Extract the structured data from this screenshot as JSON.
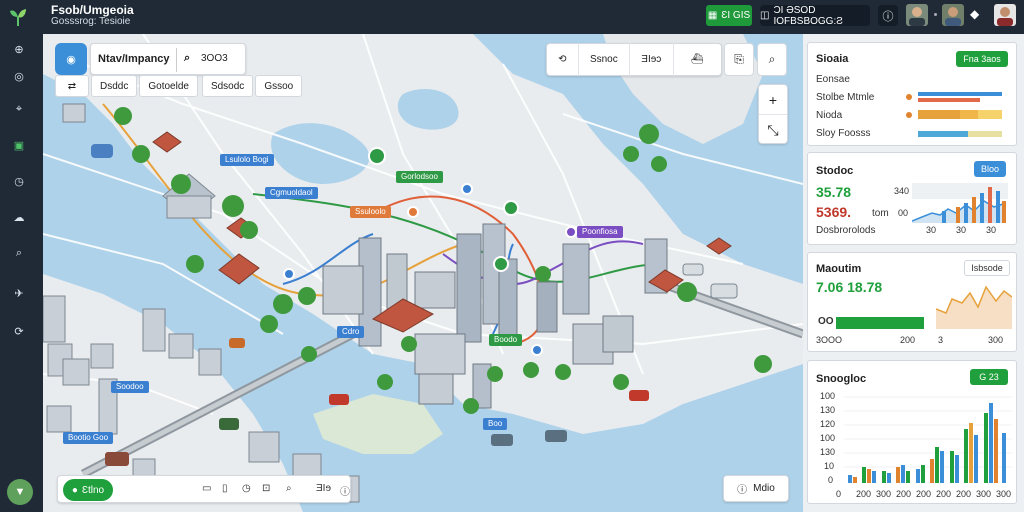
{
  "header": {
    "title": "Fsob/Umgeoia",
    "subtitle": "Gosssrog: Tesioie",
    "action_label": "ƐI GIS",
    "search_label": "ƆI ƏSOD IOFBSBOGG:Ƨ",
    "action_icon": "grid-icon",
    "search_icon": "chart-icon"
  },
  "sidebar": {
    "icons": [
      "globe-icon",
      "compass-icon",
      "pin-icon",
      "layers-icon",
      "clock-icon",
      "cloud-icon",
      "search-icon",
      "satellite-icon",
      "sync-icon"
    ],
    "bottom_icon": "filter-icon"
  },
  "map": {
    "search": {
      "label": "Ntav/Impancy",
      "query": "3OO3"
    },
    "filters": [
      "Dsddc",
      "Gotoelde",
      "Sdsodc",
      "Gssoo"
    ],
    "tool_tabs": [
      "Ssnoc",
      "ƎIɘɔ"
    ],
    "bottom_bar": {
      "pill": "Ɛtlno",
      "icons": [
        "calendar-icon",
        "lock-icon",
        "clock-icon",
        "target-icon"
      ],
      "extra": "ƎIɘ"
    },
    "legend_label": "Mdio",
    "labels": [
      {
        "text": "Lsulolo Bogi",
        "color": "#3b7fd1"
      },
      {
        "text": "Cgmuoldaol",
        "color": "#3b7fd1"
      },
      {
        "text": "Gorlodsoo",
        "color": "#2f9a45"
      },
      {
        "text": "Ssuloolo",
        "color": "#e07a3a"
      },
      {
        "text": "Poonfiosa",
        "color": "#7a4ec2"
      },
      {
        "text": "Boodo",
        "color": "#2f9a45"
      },
      {
        "text": "Cdro",
        "color": "#3b7fd1"
      },
      {
        "text": "Soodoo",
        "color": "#3b7fd1"
      },
      {
        "text": "Bootio Goo",
        "color": "#3b7fd1"
      },
      {
        "text": "Boo",
        "color": "#3b7fd1"
      }
    ]
  },
  "panels": {
    "stats": {
      "title": "Sioaia",
      "badge": "Fna 3aos",
      "rows": [
        {
          "label": "Eonsae",
          "color": null
        },
        {
          "label": "Stolbe Mtmle",
          "color": "#e0822e"
        },
        {
          "label": "Nioda",
          "color": "#e0822e"
        },
        {
          "label": "Sloy Foosss",
          "color": null
        }
      ]
    },
    "status": {
      "title": "Stodoc",
      "badge": "Bloo",
      "value1": "35.78",
      "value2": "5369.",
      "value2_suffix": "tom",
      "axis_left": [
        "340",
        "00"
      ],
      "footer": "Dosbrorolods",
      "ticks": [
        "30",
        "30",
        "30"
      ]
    },
    "monitor": {
      "title": "Maoutim",
      "badge": "Isbsode",
      "value": "7.06 18.78",
      "percent": "OO",
      "ticks": [
        "3OOO",
        "200",
        "3",
        "300"
      ]
    },
    "snapshot": {
      "title": "Snoogloc",
      "badge": "G 23",
      "y_ticks": [
        "100",
        "130",
        "120",
        "100",
        "130",
        "10",
        "0"
      ],
      "x_ticks": [
        "0",
        "200",
        "300",
        "200",
        "200",
        "200",
        "200",
        "300",
        "300"
      ]
    }
  }
}
